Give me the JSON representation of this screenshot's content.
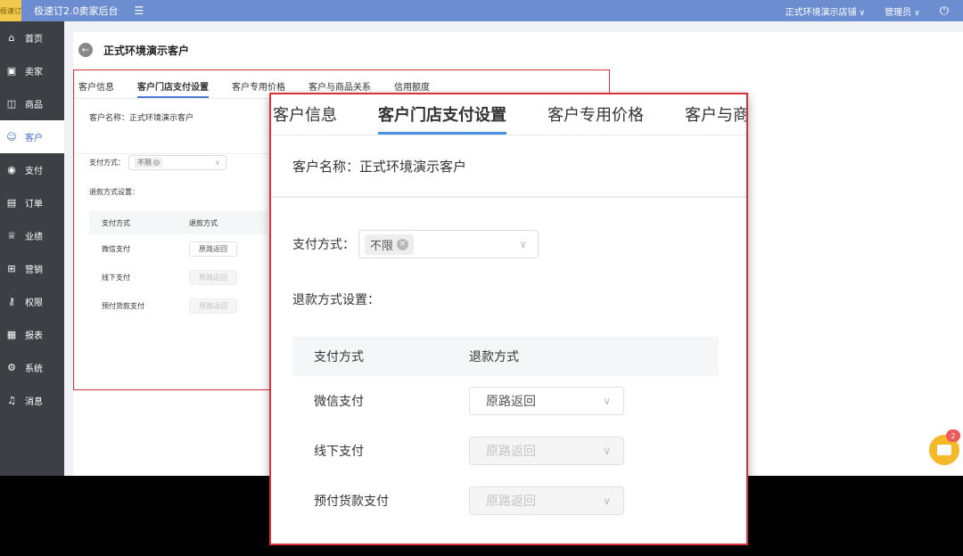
{
  "topbar": {
    "logo_text": "极速订",
    "app_title": "极速订2.0卖家后台",
    "store": "正式环境演示店铺",
    "user": "管理员"
  },
  "sidebar": {
    "items": [
      {
        "label": "首页",
        "icon": "home-icon"
      },
      {
        "label": "卖家",
        "icon": "seller-icon"
      },
      {
        "label": "商品",
        "icon": "goods-icon"
      },
      {
        "label": "客户",
        "icon": "customer-icon",
        "active": true
      },
      {
        "label": "支付",
        "icon": "payment-icon"
      },
      {
        "label": "订单",
        "icon": "order-icon"
      },
      {
        "label": "业绩",
        "icon": "trophy-icon"
      },
      {
        "label": "营销",
        "icon": "gift-icon"
      },
      {
        "label": "权限",
        "icon": "key-icon"
      },
      {
        "label": "报表",
        "icon": "report-icon"
      },
      {
        "label": "系统",
        "icon": "gear-icon"
      },
      {
        "label": "消息",
        "icon": "bell-icon"
      }
    ]
  },
  "page": {
    "title": "正式环境演示客户"
  },
  "tabs": [
    {
      "label": "客户信息"
    },
    {
      "label": "客户门店支付设置",
      "active": true
    },
    {
      "label": "客户专用价格"
    },
    {
      "label": "客户与商品关系"
    },
    {
      "label": "信用额度"
    }
  ],
  "form": {
    "customer_name_label": "客户名称：",
    "customer_name": "正式环境演示客户",
    "pay_method_label": "支付方式：",
    "pay_method_tag": "不限",
    "refund_setting_label": "退款方式设置：",
    "table_headers": [
      "支付方式",
      "退款方式"
    ],
    "rows": [
      {
        "method": "微信支付",
        "refund": "原路返回",
        "disabled": false
      },
      {
        "method": "线下支付",
        "refund": "原路返回",
        "disabled": true
      },
      {
        "method": "预付货款支付",
        "refund": "原路返回",
        "disabled": true
      }
    ]
  },
  "zoom_tabs": [
    "客户信息",
    "客户门店支付设置",
    "客户专用价格",
    "客户与商"
  ],
  "notification": {
    "count": "2"
  },
  "colors": {
    "topbar": "#6c8ed1",
    "sidebar": "#3d3f44",
    "accent": "#4a90e2",
    "highlight_border": "#d9323a",
    "fab": "#f5b829"
  }
}
